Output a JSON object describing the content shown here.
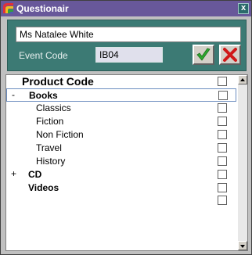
{
  "window": {
    "title": "Questionair",
    "close_glyph": "x"
  },
  "form": {
    "name_value": "Ms Natalee White",
    "event_code_label": "Event Code",
    "event_code_value": "IB04"
  },
  "buttons": {
    "ok_icon": "green-check-icon",
    "cancel_icon": "red-x-icon"
  },
  "tree": {
    "header": "Product Code",
    "items": [
      {
        "label": "Books",
        "expander": "-",
        "bold": true,
        "level": 0,
        "selected": true
      },
      {
        "label": "Classics",
        "expander": "",
        "bold": false,
        "level": 1
      },
      {
        "label": "Fiction",
        "expander": "",
        "bold": false,
        "level": 1
      },
      {
        "label": "Non Fiction",
        "expander": "",
        "bold": false,
        "level": 1
      },
      {
        "label": "Travel",
        "expander": "",
        "bold": false,
        "level": 1
      },
      {
        "label": "History",
        "expander": "",
        "bold": false,
        "level": 1
      },
      {
        "label": "CD",
        "expander": "+",
        "bold": true,
        "level": 0
      },
      {
        "label": "Videos",
        "expander": "",
        "bold": true,
        "level": 0
      }
    ]
  },
  "colors": {
    "titlebar": "#68589a",
    "panel": "#3c7a74",
    "ok_green": "#2fa82f",
    "cancel_red": "#d01818"
  }
}
